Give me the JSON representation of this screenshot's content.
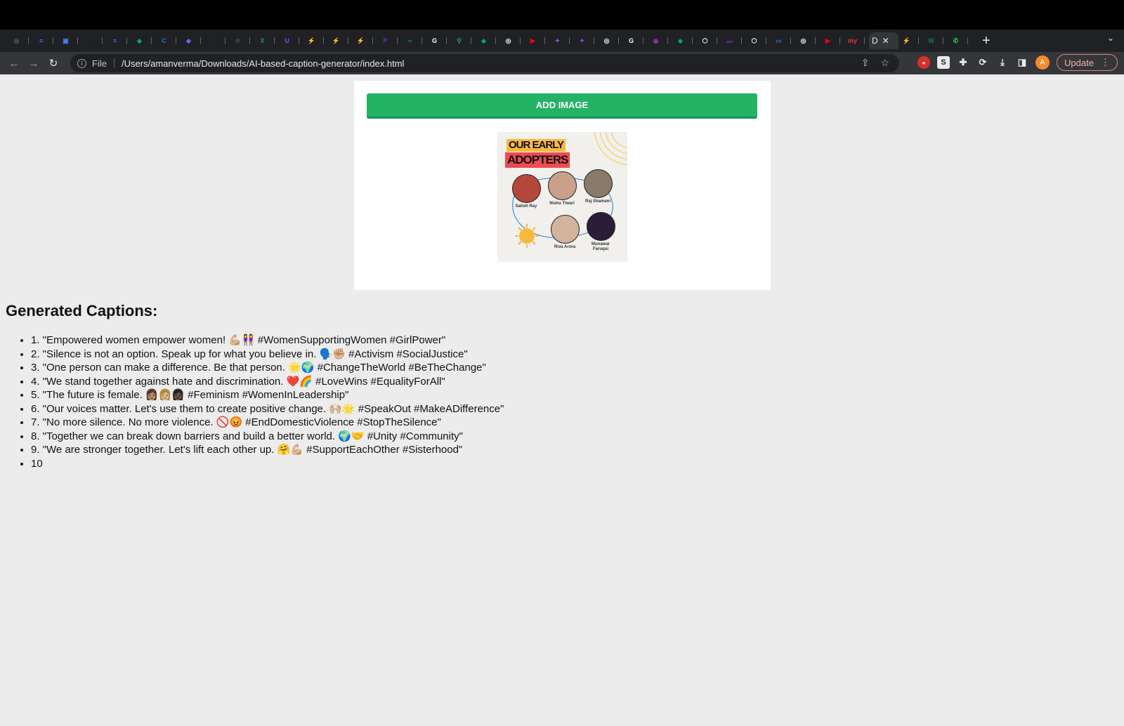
{
  "browser": {
    "tabs": [
      {
        "icon": "chrome-icon",
        "color": "#5f6368",
        "glyph": "◎"
      },
      {
        "icon": "google-docs-icon",
        "color": "#4285f4",
        "glyph": "≡"
      },
      {
        "icon": "app-icon",
        "color": "#4285f4",
        "glyph": "▣"
      },
      {
        "icon": "gmail-icon",
        "color": "#202124",
        "glyph": "M"
      },
      {
        "icon": "google-docs-icon",
        "color": "#4285f4",
        "glyph": "≡"
      },
      {
        "icon": "chatgpt-icon",
        "color": "#10a37f",
        "glyph": "◈"
      },
      {
        "icon": "c-icon",
        "color": "#1a73e8",
        "glyph": "C"
      },
      {
        "icon": "chat-icon",
        "color": "#7b61ff",
        "glyph": "◆"
      },
      {
        "icon": "r-icon",
        "color": "#202124",
        "glyph": "R"
      },
      {
        "icon": "network-icon",
        "color": "#3c4043",
        "glyph": "✱"
      },
      {
        "icon": "x-icon",
        "color": "#0f9d58",
        "glyph": "X"
      },
      {
        "icon": "purple-app-icon",
        "color": "#7c4dff",
        "glyph": "U"
      },
      {
        "icon": "leaf-icon",
        "color": "#202124",
        "glyph": "⚡"
      },
      {
        "icon": "leaf-icon",
        "color": "#202124",
        "glyph": "⚡"
      },
      {
        "icon": "leaf-icon",
        "color": "#202124",
        "glyph": "⚡"
      },
      {
        "icon": "p-icon",
        "color": "#5b2bd8",
        "glyph": "P"
      },
      {
        "icon": "green-app-icon",
        "color": "#0b8043",
        "glyph": "∞"
      },
      {
        "icon": "google-icon",
        "color": "#ffffff",
        "glyph": "G"
      },
      {
        "icon": "maps-icon",
        "color": "#34a853",
        "glyph": "⚲"
      },
      {
        "icon": "chatgpt-icon",
        "color": "#10a37f",
        "glyph": "◈"
      },
      {
        "icon": "chrome-icon",
        "color": "#ffffff",
        "glyph": "◎"
      },
      {
        "icon": "youtube-icon",
        "color": "#ff0000",
        "glyph": "▶"
      },
      {
        "icon": "spark-icon",
        "color": "#7c4dff",
        "glyph": "✦"
      },
      {
        "icon": "spark-icon",
        "color": "#7c4dff",
        "glyph": "✦"
      },
      {
        "icon": "chrome-icon",
        "color": "#ffffff",
        "glyph": "◎"
      },
      {
        "icon": "google-icon",
        "color": "#ffffff",
        "glyph": "G"
      },
      {
        "icon": "dot-icon",
        "color": "#9c27b0",
        "glyph": "◉"
      },
      {
        "icon": "chatgpt-icon",
        "color": "#10a37f",
        "glyph": "◈"
      },
      {
        "icon": "codepen-icon",
        "color": "#ffffff",
        "glyph": "⬡"
      },
      {
        "icon": "purple-app-icon",
        "color": "#6a1b9a",
        "glyph": "▬"
      },
      {
        "icon": "codepen-icon",
        "color": "#ffffff",
        "glyph": "⬡"
      },
      {
        "icon": "box-icon",
        "color": "#1a73e8",
        "glyph": "▭"
      },
      {
        "icon": "chrome-icon",
        "color": "#ffffff",
        "glyph": "◎"
      },
      {
        "icon": "youtube-icon",
        "color": "#ff0000",
        "glyph": "▶"
      },
      {
        "icon": "my-icon",
        "color": "#e53935",
        "glyph": "my"
      }
    ],
    "active_tab": {
      "label": "D",
      "close": "✕"
    },
    "extra_tabs": [
      {
        "icon": "leaf-icon",
        "color": "#f57c00",
        "glyph": "⚡"
      },
      {
        "icon": "w-icon",
        "color": "#0b8043",
        "glyph": "W"
      },
      {
        "icon": "whatsapp-icon",
        "color": "#25d366",
        "glyph": "✆"
      }
    ],
    "new_tab": "+",
    "tab_menu": "⌄",
    "file_label": "File",
    "url": "/Users/amanverma/Downloads/AI-based-caption-generator/index.html",
    "update_label": "Update",
    "avatar_letter": "A"
  },
  "page": {
    "add_image_label": "ADD IMAGE",
    "poster": {
      "title_line1": "OUR EARLY",
      "title_line2": "ADOPTERS",
      "people": [
        {
          "name": "Satish Ray",
          "color": "#b5473a"
        },
        {
          "name": "Nishu Tiwari",
          "color": "#c9a08a"
        },
        {
          "name": "Raj Shamani",
          "color": "#8a7a6a"
        },
        {
          "name": "Riva Arora",
          "color": "#d2b49c"
        },
        {
          "name": "Munawar Faruqui",
          "color": "#2b1d3a"
        }
      ]
    },
    "captions_title": "Generated Captions:",
    "captions": [
      "1. \"Empowered women empower women! 💪🏼👭 #WomenSupportingWomen #GirlPower\"",
      "2. \"Silence is not an option. Speak up for what you believe in. 🗣️✊🏼 #Activism #SocialJustice\"",
      "3. \"One person can make a difference. Be that person. 🌟🌍 #ChangeTheWorld #BeTheChange\"",
      "4. \"We stand together against hate and discrimination. ❤️🌈 #LoveWins #EqualityForAll\"",
      "5. \"The future is female. 👩🏽👩🏼👩🏿 #Feminism #WomenInLeadership\"",
      "6. \"Our voices matter. Let's use them to create positive change. 🙌🏼🌟 #SpeakOut #MakeADifference\"",
      "7. \"No more silence. No more violence. 🚫😡 #EndDomesticViolence #StopTheSilence\"",
      "8. \"Together we can break down barriers and build a better world. 🌍🤝 #Unity #Community\"",
      "9. \"We are stronger together. Let's lift each other up. 🤗💪🏼 #SupportEachOther #Sisterhood\"",
      "10"
    ]
  }
}
